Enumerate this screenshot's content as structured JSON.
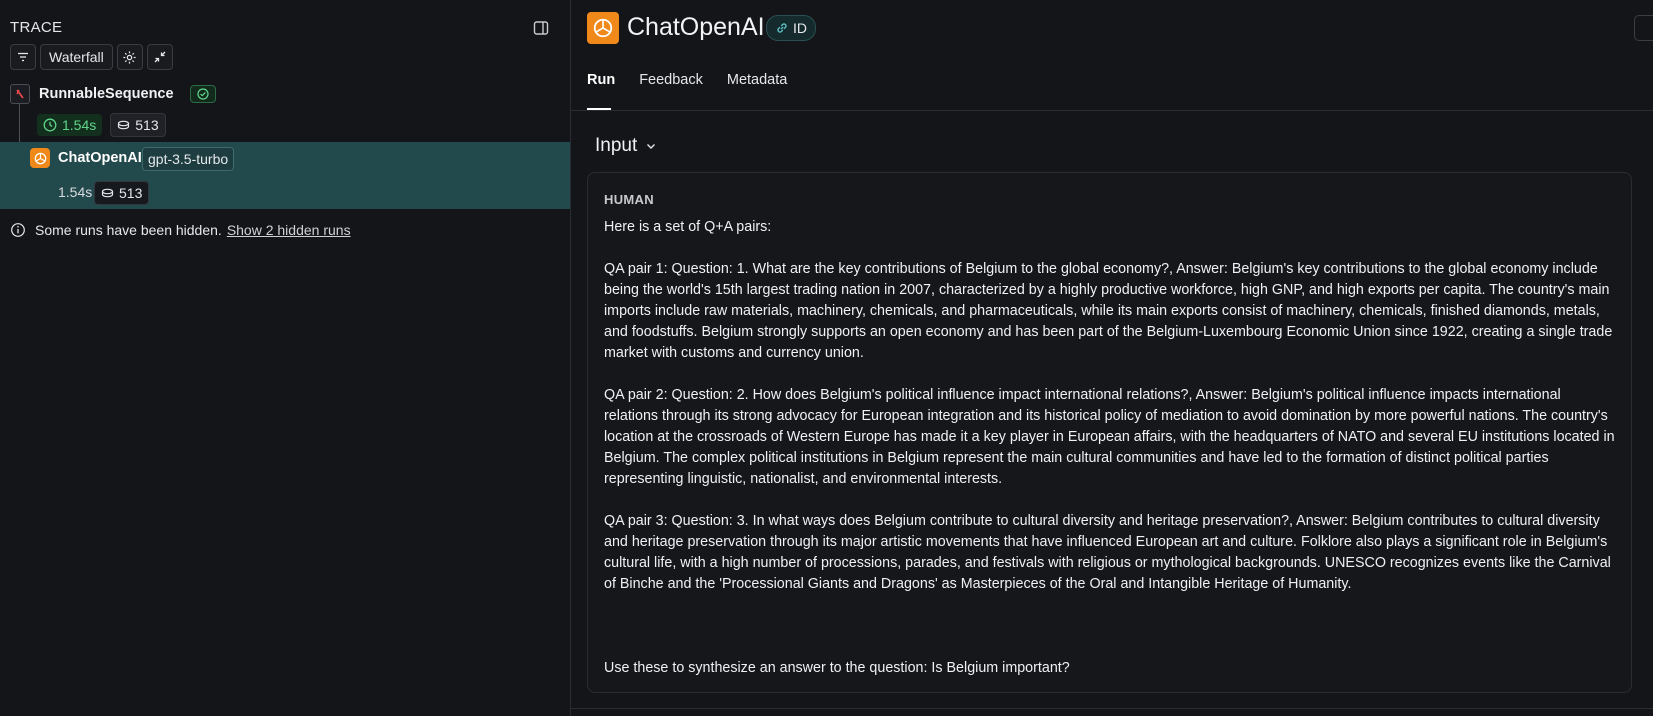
{
  "trace_panel": {
    "title": "TRACE",
    "toolbar": {
      "view_label": "Waterfall"
    },
    "runs": [
      {
        "name": "RunnableSequence",
        "latency": "1.54s",
        "tokens": "513",
        "status": "success"
      },
      {
        "name": "ChatOpenAI",
        "model": "gpt-3.5-turbo",
        "latency": "1.54s",
        "tokens": "513"
      }
    ],
    "hidden_notice": {
      "text": "Some runs have been hidden.",
      "link": "Show 2 hidden runs"
    }
  },
  "run_detail": {
    "title": "ChatOpenAI",
    "id_label": "ID",
    "tabs": [
      {
        "label": "Run",
        "active": true
      },
      {
        "label": "Feedback",
        "active": false
      },
      {
        "label": "Metadata",
        "active": false
      }
    ],
    "input_section": {
      "heading": "Input",
      "message": {
        "role": "HUMAN",
        "text": "Here is a set of Q+A pairs:\n\nQA pair 1: Question: 1. What are the key contributions of Belgium to the global economy?, Answer: Belgium's key contributions to the global economy include being the world's 15th largest trading nation in 2007, characterized by a highly productive workforce, high GNP, and high exports per capita. The country's main imports include raw materials, machinery, chemicals, and pharmaceuticals, while its main exports consist of machinery, chemicals, finished diamonds, metals, and foodstuffs. Belgium strongly supports an open economy and has been part of the Belgium-Luxembourg Economic Union since 1922, creating a single trade market with customs and currency union.\n\nQA pair 2: Question: 2. How does Belgium's political influence impact international relations?, Answer: Belgium's political influence impacts international relations through its strong advocacy for European integration and its historical policy of mediation to avoid domination by more powerful nations. The country's location at the crossroads of Western Europe has made it a key player in European affairs, with the headquarters of NATO and several EU institutions located in Belgium. The complex political institutions in Belgium represent the main cultural communities and have led to the formation of distinct political parties representing linguistic, nationalist, and environmental interests.\n\nQA pair 3: Question: 3. In what ways does Belgium contribute to cultural diversity and heritage preservation?, Answer: Belgium contributes to cultural diversity and heritage preservation through its major artistic movements that have influenced European art and culture. Folklore also plays a significant role in Belgium's cultural life, with a high number of processions, parades, and festivals with religious or mythological backgrounds. UNESCO recognizes events like the Carnival of Binche and the 'Processional Giants and Dragons' as Masterpieces of the Oral and Intangible Heritage of Humanity.\n\n\n\nUse these to synthesize an answer to the question: Is Belgium important?"
      }
    }
  },
  "colors": {
    "background": "#141518",
    "selected_row": "#22494c",
    "success_green": "#5fd68a",
    "openai_orange": "#f0891a"
  },
  "icons": {
    "filter": "filter-icon",
    "settings": "gear-icon",
    "collapse": "collapse-arrows-icon",
    "sidebar_toggle": "sidebar-toggle-icon",
    "sequence": "runnable-sequence-icon",
    "openai": "openai-logo-icon",
    "clock": "clock-icon",
    "tokens": "token-coins-icon",
    "check": "check-circle-icon",
    "info": "info-icon",
    "link": "link-icon",
    "chevron": "chevron-down-icon"
  }
}
